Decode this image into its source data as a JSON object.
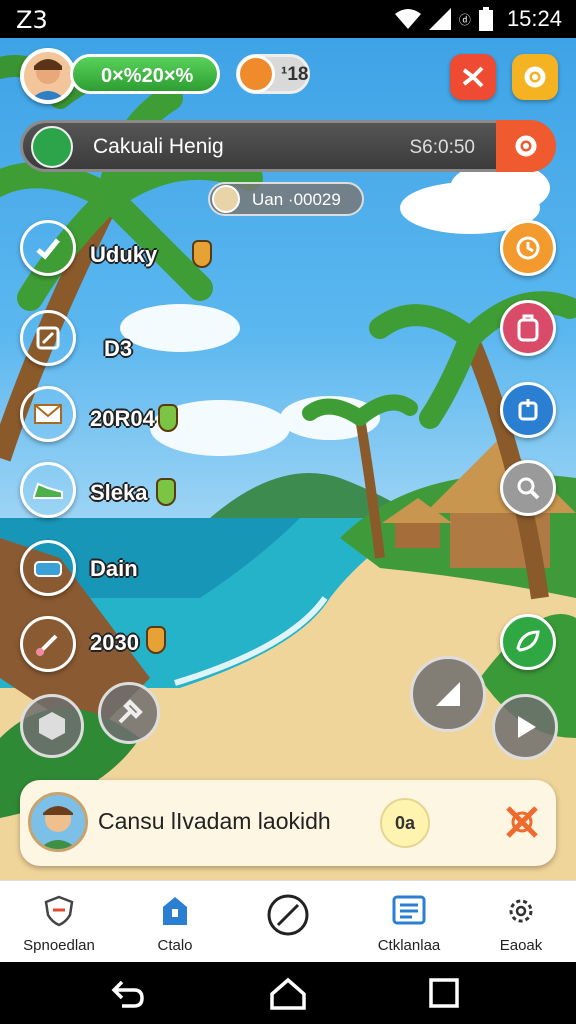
{
  "status_bar": {
    "left_text": "Z3",
    "time": "15:24",
    "battery_label": "ⓓ"
  },
  "hud": {
    "coins": "0×%20×%",
    "gems": "¹18"
  },
  "player_bar": {
    "name": "Cakuali Henig",
    "score": "S6:0:50"
  },
  "sub_pill": {
    "text": "Uan ·00029"
  },
  "side_menu": [
    {
      "label": "Uduky",
      "color": "#f15a26"
    },
    {
      "label": "D3",
      "color": "#2c7bd6"
    },
    {
      "label": "20R04",
      "color": "#f4c21f"
    },
    {
      "label": "Sleka",
      "color": "#7db8e0"
    },
    {
      "label": "Dain",
      "color": "#e54b2a"
    },
    {
      "label": "2030",
      "color": "#2a73d0"
    }
  ],
  "chat": {
    "text": "Cansu lIvadam laokidh",
    "badge": "0a"
  },
  "bottom_nav": [
    {
      "label": "Spnoedlan",
      "icon": "shield-icon"
    },
    {
      "label": "Ctalo",
      "icon": "home-icon"
    },
    {
      "label": "",
      "icon": "compass-icon"
    },
    {
      "label": "Ctklanlaa",
      "icon": "list-icon"
    },
    {
      "label": "Eaoak",
      "icon": "gear-icon"
    }
  ]
}
